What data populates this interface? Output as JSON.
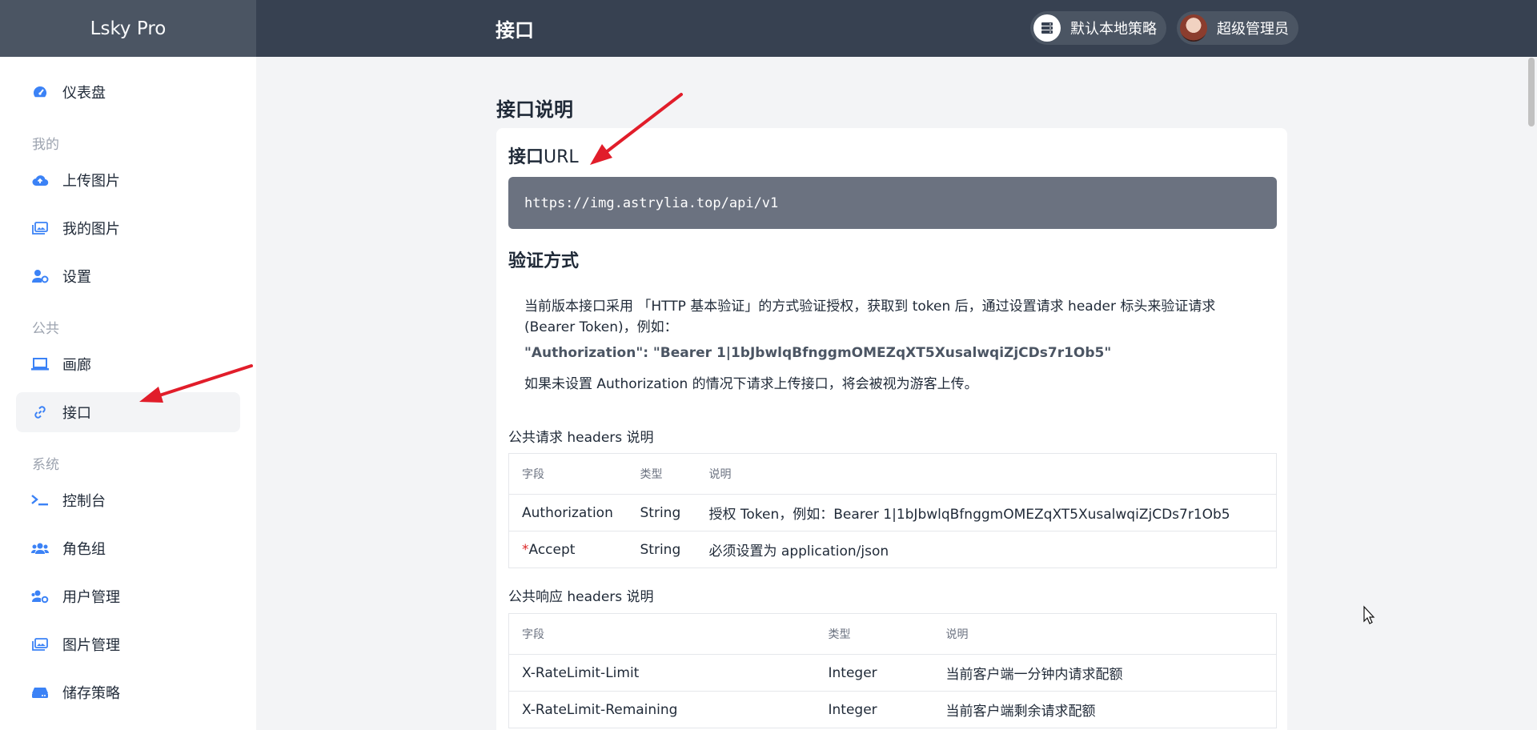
{
  "header": {
    "brand": "Lsky Pro",
    "title": "接口",
    "strategy_label": "默认本地策略",
    "user_label": "超级管理员"
  },
  "sidebar": {
    "items": [
      {
        "label": "仪表盘",
        "icon": "dashboard-icon"
      },
      {
        "section": "我的"
      },
      {
        "label": "上传图片",
        "icon": "cloud-upload-icon"
      },
      {
        "label": "我的图片",
        "icon": "images-icon"
      },
      {
        "label": "设置",
        "icon": "user-settings-icon"
      },
      {
        "section": "公共"
      },
      {
        "label": "画廊",
        "icon": "laptop-icon"
      },
      {
        "label": "接口",
        "icon": "link-icon",
        "active": true
      },
      {
        "section": "系统"
      },
      {
        "label": "控制台",
        "icon": "terminal-icon"
      },
      {
        "label": "角色组",
        "icon": "users-icon"
      },
      {
        "label": "用户管理",
        "icon": "users-cog-icon"
      },
      {
        "label": "图片管理",
        "icon": "images-icon"
      },
      {
        "label": "储存策略",
        "icon": "hdd-icon"
      }
    ],
    "labels": {
      "dashboard": "仪表盘",
      "sec_mine": "我的",
      "upload": "上传图片",
      "my_images": "我的图片",
      "settings": "设置",
      "sec_public": "公共",
      "gallery": "画廊",
      "api": "接口",
      "sec_system": "系统",
      "console": "控制台",
      "roles": "角色组",
      "users": "用户管理",
      "image_mgmt": "图片管理",
      "storage": "储存策略"
    }
  },
  "main": {
    "heading": "接口说明",
    "url_heading_bold": "接口",
    "url_heading_rest": "URL",
    "url": "https://img.astrylia.top/api/v1",
    "auth_heading": "验证方式",
    "auth_desc": "当前版本接口采用 「HTTP 基本验证」的方式验证授权，获取到 token 后，通过设置请求 header 标头来验证请求 (Bearer Token)，例如：",
    "auth_example": "\"Authorization\": \"Bearer 1|1bJbwlqBfnggmOMEZqXT5XusalwqiZjCDs7r1Ob5\"",
    "auth_note": "如果未设置 Authorization 的情况下请求上传接口，将会被视为游客上传。",
    "req_headers_title": "公共请求 headers 说明",
    "req_headers": {
      "columns": [
        "字段",
        "类型",
        "说明"
      ],
      "rows": [
        {
          "field": "Authorization",
          "required": false,
          "type": "String",
          "desc": "授权 Token，例如：Bearer 1|1bJbwlqBfnggmOMEZqXT5XusalwqiZjCDs7r1Ob5"
        },
        {
          "field": "Accept",
          "required": true,
          "required_mark": "*",
          "type": "String",
          "desc": "必须设置为 application/json"
        }
      ]
    },
    "resp_headers_title": "公共响应 headers 说明",
    "resp_headers": {
      "columns": [
        "字段",
        "类型",
        "说明"
      ],
      "rows": [
        {
          "field": "X-RateLimit-Limit",
          "type": "Integer",
          "desc": "当前客户端一分钟内请求配额"
        },
        {
          "field": "X-RateLimit-Remaining",
          "type": "Integer",
          "desc": "当前客户端剩余请求配额"
        }
      ]
    }
  },
  "colors": {
    "accent": "#3b82f6",
    "header_bg": "#374151",
    "annotation_arrow": "#e11d2a"
  }
}
